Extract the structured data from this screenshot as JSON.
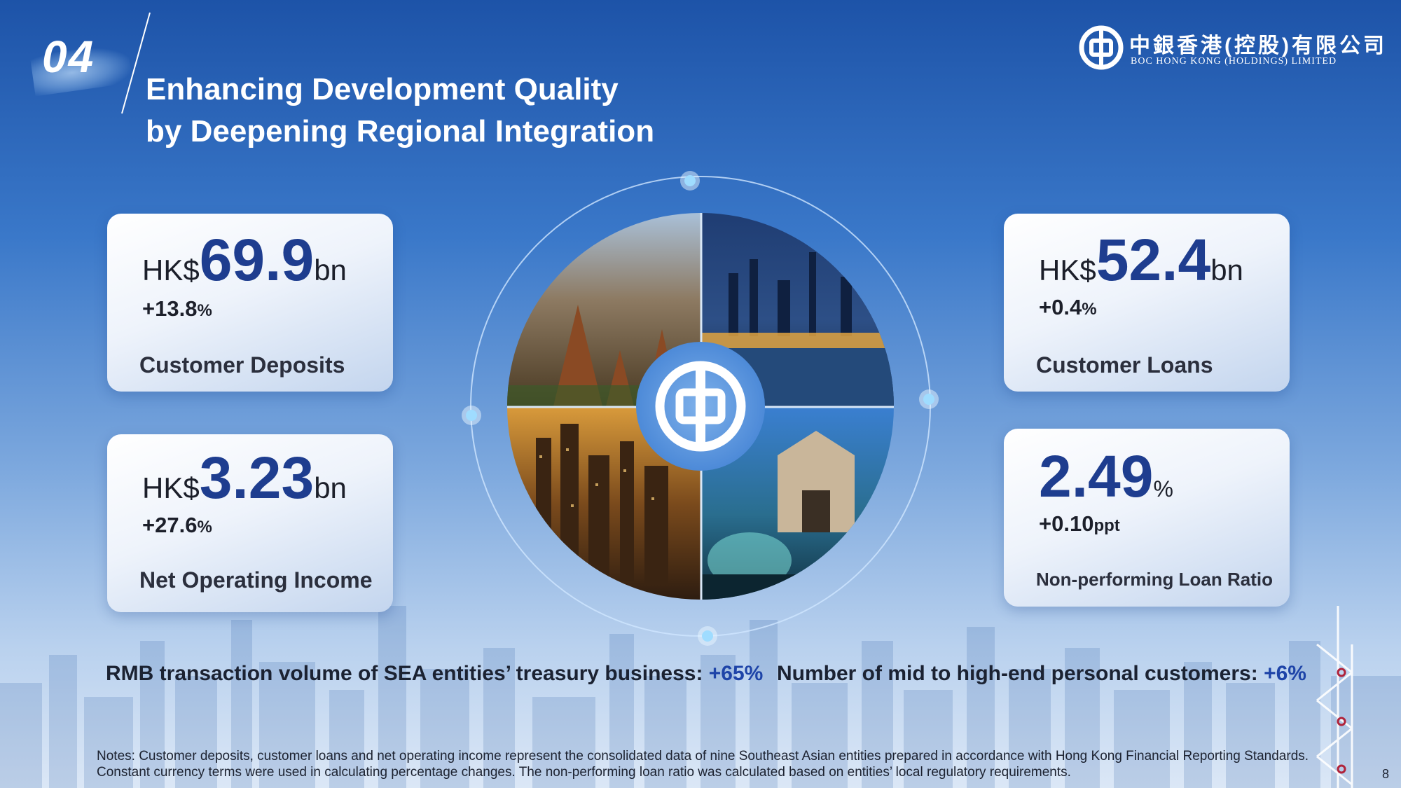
{
  "section": {
    "number": "04"
  },
  "title": {
    "line1": "Enhancing Development Quality",
    "line2": "by Deepening Regional Integration"
  },
  "logo": {
    "cn": "中銀香港(控股)有限公司",
    "en": "BOC HONG KONG (HOLDINGS) LIMITED"
  },
  "kpis": {
    "deposits": {
      "prefix": "HK$",
      "value": "69.9",
      "suffix": "bn",
      "change": "+13.8",
      "change_unit": "%",
      "label": "Customer Deposits"
    },
    "income": {
      "prefix": "HK$",
      "value": "3.23",
      "suffix": "bn",
      "change": "+27.6",
      "change_unit": "%",
      "label": "Net Operating Income"
    },
    "loans": {
      "prefix": "HK$",
      "value": "52.4",
      "suffix": "bn",
      "change": "+0.4",
      "change_unit": "%",
      "label": "Customer Loans"
    },
    "npl": {
      "value": "2.49",
      "suffix": "%",
      "change": "+0.10",
      "change_unit": "ppt",
      "label": "Non-performing Loan Ratio"
    }
  },
  "bottom": {
    "rmb": {
      "text": "RMB transaction volume of SEA entities’ treasury business: ",
      "value": "+65%"
    },
    "customers": {
      "text": "Number of mid to high-end personal customers:  ",
      "value": "+6%"
    }
  },
  "notes": "Notes: Customer deposits, customer loans and net operating income represent the consolidated data of nine Southeast Asian entities prepared in accordance with Hong Kong Financial Reporting Standards. Constant currency terms were used in calculating percentage changes. The non-performing loan ratio was calculated based on entities’ local regulatory requirements.",
  "page_number": "8",
  "colors": {
    "background_top": "#1d53a8",
    "value_blue": "#1e3d8f",
    "highlight_blue": "#1e44a8",
    "accent_red": "#b0223a"
  }
}
